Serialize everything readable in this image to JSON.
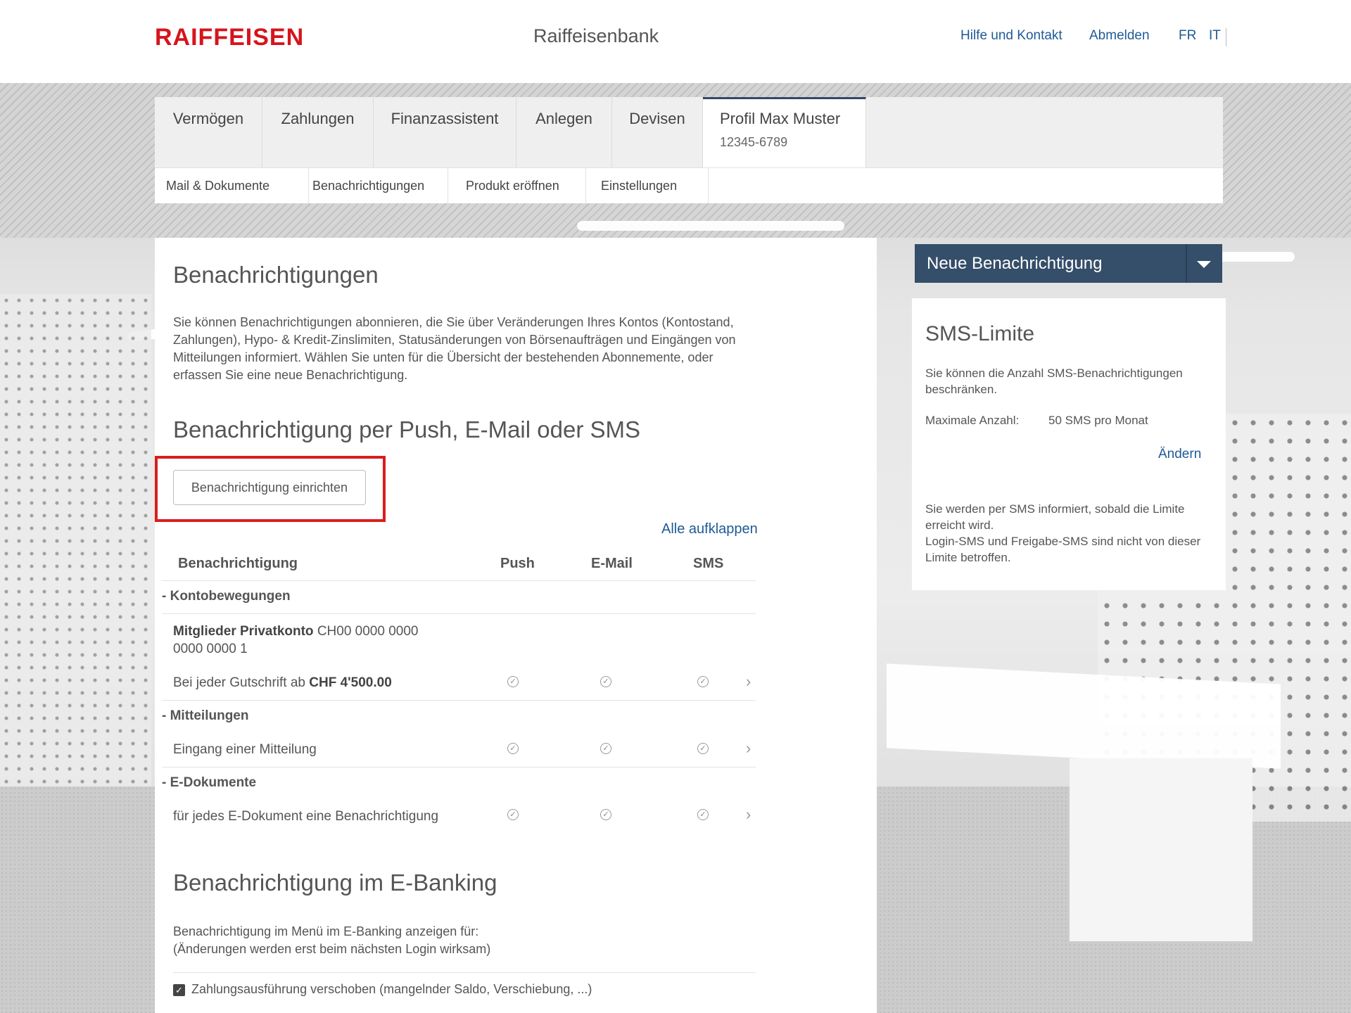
{
  "header": {
    "logo": "RAIFFEISEN",
    "bank_name": "Raiffeisenbank",
    "help": "Hilfe und Kontakt",
    "logout": "Abmelden",
    "lang_fr": "FR",
    "lang_it": "IT"
  },
  "nav": {
    "tabs": [
      "Vermögen",
      "Zahlungen",
      "Finanzassistent",
      "Anlegen",
      "Devisen"
    ],
    "profile_title": "Profil Max Muster",
    "profile_number": "12345-6789",
    "subnav": [
      "Mail & Dokumente",
      "Benachrichtigungen",
      "Produkt eröffnen",
      "Einstellungen"
    ]
  },
  "main": {
    "title": "Benachrichtigungen",
    "intro": "Sie können Benachrichtigungen abonnieren, die Sie über Veränderungen Ihres Kontos (Kontostand, Zahlungen), Hypo- & Kredit-Zinslimiten, Statusänderungen von Börsenaufträgen und Eingängen von Mitteilungen informiert. Wählen Sie unten für die Übersicht der bestehenden Abonnemente, oder erfassen Sie eine neue Benachrichtigung.",
    "section_push_title": "Benachrichtigung per Push, E-Mail oder SMS",
    "setup_button": "Benachrichtigung einrichten",
    "expand_all": "Alle aufklappen",
    "columns": {
      "name": "Benachrichtigung",
      "push": "Push",
      "email": "E-Mail",
      "sms": "SMS"
    },
    "groups": {
      "konto": {
        "label": "Kontobewegungen",
        "account_name": "Mitglieder Privatkonto",
        "account_iban_1": "CH00 0000 0000",
        "account_iban_2": "0000 0000 1",
        "rule_prefix": "Bei jeder Gutschrift ab",
        "rule_amount": "CHF 4'500.00"
      },
      "mitteilungen": {
        "label": "Mitteilungen",
        "rule": "Eingang einer Mitteilung"
      },
      "edokumente": {
        "label": "E-Dokumente",
        "rule": "für jedes E-Dokument eine Benachrichtigung"
      }
    },
    "section_ebanking_title": "Benachrichtigung im E-Banking",
    "ebanking_line1": "Benachrichtigung im Menü im E-Banking anzeigen für:",
    "ebanking_line2": "(Änderungen werden erst beim nächsten Login wirksam)",
    "checkbox_label": "Zahlungsausführung verschoben (mangelnder Saldo, Verschiebung, ...)"
  },
  "sidebar": {
    "dropdown_label": "Neue Benachrichtigung",
    "sms_title": "SMS-Limite",
    "sms_desc": "Sie können die Anzahl SMS-Benachrichtigungen beschränken.",
    "max_label": "Maximale Anzahl:",
    "max_value": "50 SMS pro Monat",
    "change_link": "Ändern",
    "info_line1": "Sie werden per SMS informiert, sobald die Limite erreicht wird.",
    "info_line2": "Login-SMS und Freigabe-SMS sind nicht von dieser Limite betroffen."
  },
  "colors": {
    "brand_red": "#d6141c",
    "link_blue": "#1f5a96",
    "dropdown_navy": "#354e69",
    "highlight_red": "#d91e1e"
  }
}
